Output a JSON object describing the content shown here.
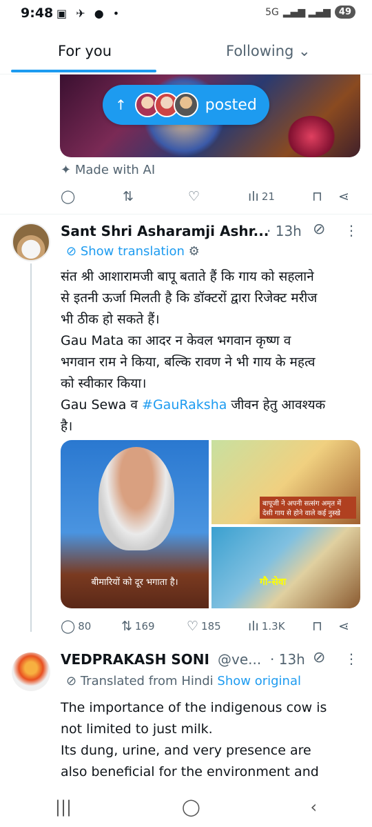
{
  "status_bar": {
    "time": "9:48",
    "icons": "▣ ✈ ● •",
    "network": "5G",
    "battery": "49"
  },
  "tabs": [
    {
      "label": "For you",
      "active": true
    },
    {
      "label": "Following",
      "chevron": "chevron-down-icon"
    }
  ],
  "posted_pill": {
    "arrow": "↑",
    "label": "posted"
  },
  "first_post": {
    "made_with_ai": "Made with AI",
    "views": "21"
  },
  "post": {
    "author": "Sant Shri Asharamji Ashr...",
    "time": "· 13h",
    "show_translation": "Show translation",
    "body": [
      "संत श्री आशारामजी बापू बताते हैं कि गाय को सहलाने",
      "से इतनी ऊर्जा मिलती है कि डॉक्टरों द्वारा रिजेक्ट मरीज",
      "भी ठीक हो सकते हैं।",
      "Gau Mata का आदर न केवल भगवान कृष्ण व",
      "भगवान राम ने किया, बल्कि रावण ने भी गाय के महत्व",
      "को स्वीकार किया।"
    ],
    "body_last_prefix": "Gau Sewa व ",
    "hashtag": "#GauRaksha",
    "body_last_suffix": " जीवन हेतु आवश्यक",
    "body_end": "है।",
    "media_captions": {
      "left": "बीमारियों को दूर भगाता है।",
      "right_top": "बापूजी ने अपनी सत्संग अमृत में देसी गाय से होने वाले कई नुस्खे",
      "right_bottom": "गौ-सेवा"
    },
    "replies": "80",
    "reposts": "169",
    "likes": "185",
    "views": "1.3K"
  },
  "reply": {
    "author": "VEDPRAKASH SONI",
    "handle": "@ve...",
    "time": "· 13h",
    "translated": "Translated from Hindi",
    "show_original": "Show original",
    "body": [
      "The importance of the indigenous cow is",
      "not limited to just milk.",
      "Its dung, urine, and very presence are",
      "also beneficial for the environment and"
    ]
  },
  "nav": {
    "recent": "|||",
    "home": "◯",
    "back": "‹"
  }
}
